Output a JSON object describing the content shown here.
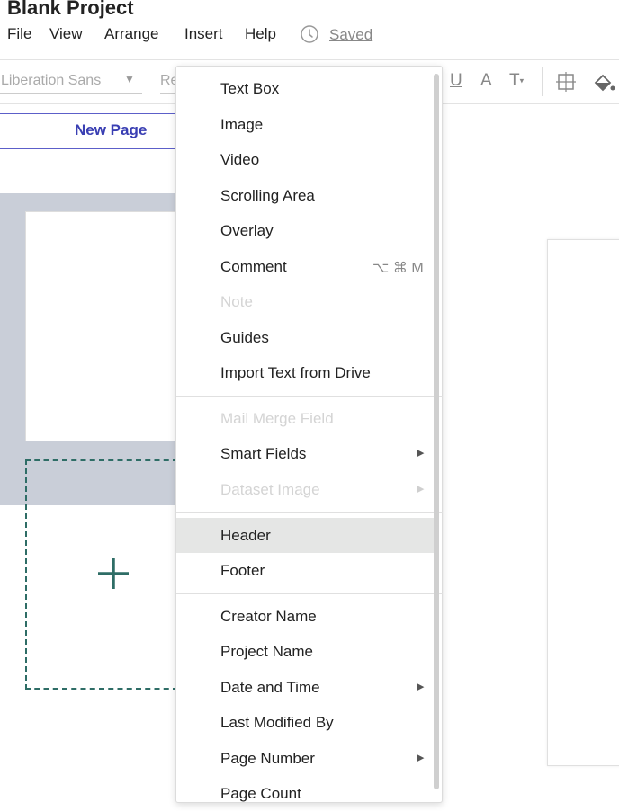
{
  "app": {
    "title": "Blank Project",
    "menu": [
      "File",
      "View",
      "Arrange",
      "Insert",
      "Help"
    ],
    "saved_label": "Saved"
  },
  "toolbar": {
    "font_family": "Liberation Sans",
    "font_size_partial": "Re",
    "icons": [
      "underline-icon",
      "text-color-icon",
      "text-size-icon",
      "crop-icon",
      "fill-bucket-icon"
    ]
  },
  "sidebar": {
    "new_page_label": "New Page"
  },
  "insert_menu": {
    "items": [
      {
        "label": "Text Box"
      },
      {
        "label": "Image"
      },
      {
        "label": "Video"
      },
      {
        "label": "Scrolling Area"
      },
      {
        "label": "Overlay"
      },
      {
        "label": "Comment",
        "shortcut": "⌥ ⌘ M"
      },
      {
        "label": "Note",
        "disabled": true
      },
      {
        "label": "Guides"
      },
      {
        "label": "Import Text from Drive"
      },
      {
        "label": "Mail Merge Field",
        "disabled": true
      },
      {
        "label": "Smart Fields",
        "submenu": true
      },
      {
        "label": "Dataset Image",
        "disabled": true,
        "submenu": true
      },
      {
        "label": "Header",
        "highlighted": true
      },
      {
        "label": "Footer"
      },
      {
        "label": "Creator Name"
      },
      {
        "label": "Project Name"
      },
      {
        "label": "Date and Time",
        "submenu": true
      },
      {
        "label": "Last Modified By"
      },
      {
        "label": "Page Number",
        "submenu": true
      },
      {
        "label": "Page Count"
      }
    ]
  },
  "colors": {
    "accent": "#3a3fb3",
    "add_page_dashes": "#2e6d66",
    "sidebar_bg": "#c9ced8",
    "highlight": "#e5e6e5"
  }
}
